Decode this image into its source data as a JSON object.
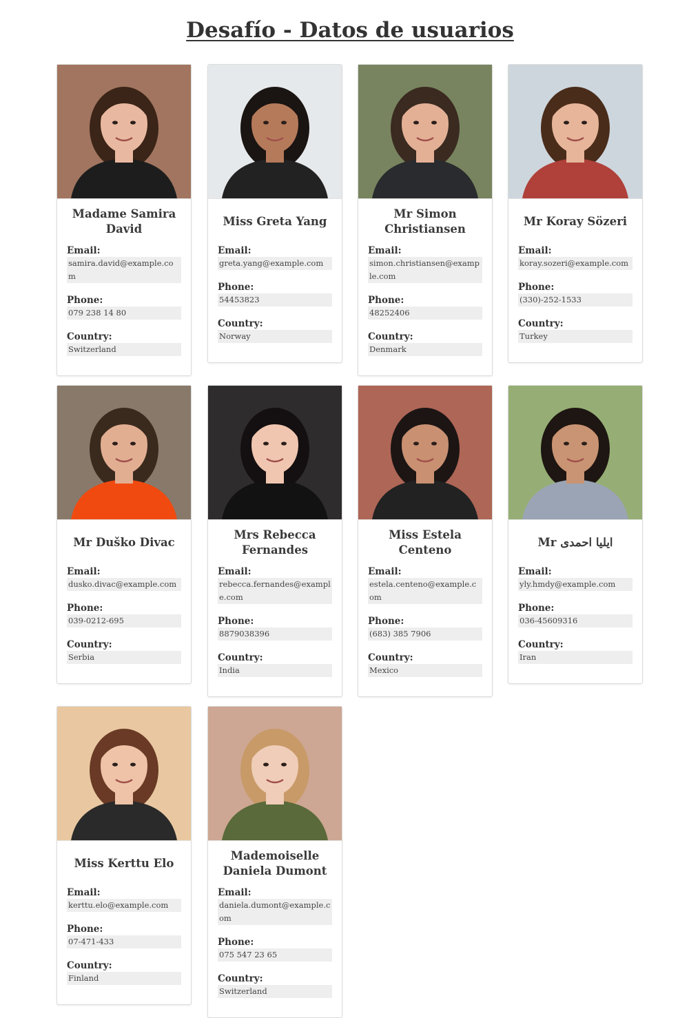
{
  "page": {
    "title": "Desafío - Datos de usuarios"
  },
  "labels": {
    "email": "Email:",
    "phone": "Phone:",
    "country": "Country:"
  },
  "users": [
    {
      "name": "Madame Samira David",
      "email": "samira.david@example.com",
      "phone": "079 238 14 80",
      "country": "Switzerland",
      "photo": {
        "bg": "#9a6a52",
        "skin": "#e8b9a0",
        "hair": "#3b2418",
        "shirt": "#1d1d1d"
      }
    },
    {
      "name": "Miss Greta Yang",
      "email": "greta.yang@example.com",
      "phone": "54453823",
      "country": "Norway",
      "photo": {
        "bg": "#e4e8ea",
        "skin": "#b57a5a",
        "hair": "#1a1412",
        "shirt": "#222222"
      }
    },
    {
      "name": "Mr Simon Christiansen",
      "email": "simon.christiansen@example.com",
      "phone": "48252406",
      "country": "Denmark",
      "photo": {
        "bg": "#6d7a52",
        "skin": "#e3b096",
        "hair": "#3a2a20",
        "shirt": "#2a2b2e"
      }
    },
    {
      "name": "Mr Koray Sözeri",
      "email": "koray.sozeri@example.com",
      "phone": "(330)-252-1533",
      "country": "Turkey",
      "photo": {
        "bg": "#c9d3db",
        "skin": "#e6b59a",
        "hair": "#4a2c1a",
        "shirt": "#b0403a"
      }
    },
    {
      "name": "Mr Duško Divac",
      "email": "dusko.divac@example.com",
      "phone": "039-0212-695",
      "country": "Serbia",
      "photo": {
        "bg": "#7e6e5e",
        "skin": "#e2ae92",
        "hair": "#3a2a1e",
        "shirt": "#f04a10"
      }
    },
    {
      "name": "Mrs Rebecca Fernandes",
      "email": "rebecca.fernandes@example.com",
      "phone": "8879038396",
      "country": "India",
      "photo": {
        "bg": "#1e1b1c",
        "skin": "#f0c6b0",
        "hair": "#140f10",
        "shirt": "#121212"
      }
    },
    {
      "name": "Miss Estela Centeno",
      "email": "estela.centeno@example.com",
      "phone": "(683) 385 7906",
      "country": "Mexico",
      "photo": {
        "bg": "#a85a48",
        "skin": "#c99072",
        "hair": "#1c1514",
        "shirt": "#222222"
      }
    },
    {
      "name": "Mr ایلیا احمدی",
      "email": "yly.hmdy@example.com",
      "phone": "036-45609316",
      "country": "Iran",
      "photo": {
        "bg": "#8ea86a",
        "skin": "#c99473",
        "hair": "#1e1612",
        "shirt": "#9aa4b4"
      }
    },
    {
      "name": "Miss Kerttu Elo",
      "email": "kerttu.elo@example.com",
      "phone": "07-471-433",
      "country": "Finland",
      "photo": {
        "bg": "#e8c49a",
        "skin": "#eec3a8",
        "hair": "#6a3a26",
        "shirt": "#2a2a2a"
      }
    },
    {
      "name": "Mademoiselle Daniela Dumont",
      "email": "daniela.dumont@example.com",
      "phone": "075 547 23 65",
      "country": "Switzerland",
      "photo": {
        "bg": "#c9a08a",
        "skin": "#f0cdb8",
        "hair": "#c89a68",
        "shirt": "#5a6a3a"
      }
    }
  ]
}
